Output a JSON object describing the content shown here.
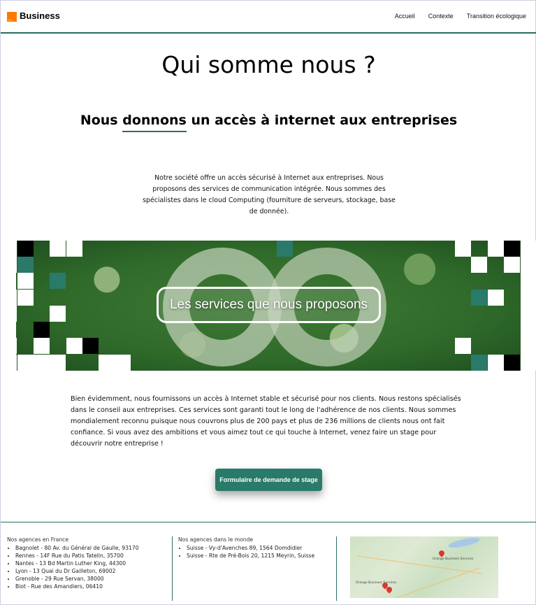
{
  "header": {
    "logo_text": "orange",
    "brand": "Business",
    "nav": [
      "Accueil",
      "Contexte",
      "Transition écologique"
    ]
  },
  "hero": {
    "title": "Qui somme nous ?",
    "subtitle_before": "Nous ",
    "subtitle_underlined": "donnons",
    "subtitle_after": " un accès à internet aux entreprises",
    "intro": "Notre société offre un accès sécurisé à Internet aux entreprises. Nous proposons des services de communication intégrée. Nous sommes des spécialistes dans le cloud Computing (fourniture de serveurs, stockage, base de donnée)."
  },
  "banner": {
    "button_label": "Les services que nous proposons"
  },
  "body_text": "Bien évidemment, nous fournissons un accès à Internet stable et sécurisé pour nos clients. Nous restons spécialisés dans le conseil aux entreprises. Ces services sont garanti tout le long de l'adhérence de nos clients. Nous sommes mondialement reconnu puisque nous couvrons plus de 200 pays et plus de 236 millions de clients nous ont fait confiance. Si vous avez des ambitions et vous aimez tout ce qui touche à Internet, venez faire un stage pour découvrir notre entreprise !",
  "cta_label": "Formulaire de demande de stage",
  "footer": {
    "france_title": "Nos agences en France",
    "france": [
      "Bagnolet - 80 Av. du Général de Gaulle, 93170",
      "Rennes - 14F Rue du Patis Tatelin, 35700",
      "Nantes - 13 Bd Martin Luther King, 44300",
      "Lyon - 13 Quai du Dr Gailleton, 69002",
      "Grenoble - 29 Rue Servan, 38000",
      "Biot - Rue des Amandiers, 06410"
    ],
    "world_title": "Nos agences dans le monde",
    "world": [
      "Suisse - Vy-d'Avenches 89, 1564 Domdidier",
      "Suisse - Rte de Pré-Bois 20, 1215 Meyrin, Suisse"
    ],
    "map_labels": [
      "Orange Business Services",
      "Orange Business Services"
    ]
  },
  "colors": {
    "accent": "#2a7a6a",
    "brand": "#ff7900"
  }
}
